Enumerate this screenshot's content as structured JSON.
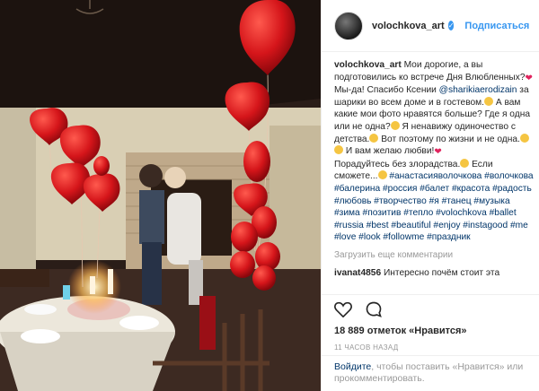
{
  "post": {
    "username": "volochkova_art",
    "verified_mark": "✓",
    "follow_label": "Подписаться"
  },
  "caption": {
    "author": "volochkova_art",
    "text_1": " Мои дорогие, а вы подготовились ко встрече Дня Влюбленных?",
    "text_2": " Мы-да! Спасибо Ксении ",
    "mention": "@sharikiaerodizain",
    "text_3": " за шарики во всем доме и в гостевом.",
    "text_4": " А вам какие мои фото нравятся больше? Где я одна или не одна?",
    "text_5": " Я ненавижу одиночество с детства.",
    "text_6": " Вот поэтому по жизни и не одна.",
    "text_7": " И вам желаю любви!",
    "text_8": "Порадуйтесь без злорадства.",
    "text_9": " Если сможете...",
    "hashtags": "#анастасияволочкова #волочкова #балерина #россия #балет #красота #радость #любовь #творчество #я #танец #музыка #зима #позитив #тепло #volochkova #ballet #russia #best #beautiful #enjoy #instagood #me #love #look #followme #праздник"
  },
  "load_more": "Загрузить еще комментарии",
  "comment": {
    "author": "ivanat4856",
    "text": " Интересно почём стоит эта"
  },
  "likes_text": "18 889 отметок «Нравится»",
  "time_ago": "11 ЧАСОВ НАЗАД",
  "login": {
    "link": "Войдите",
    "text": ", чтобы поставить «Нравится» или прокомментировать."
  },
  "colors": {
    "accent": "#3897f0",
    "link": "#003569",
    "balloon": "#d9141b"
  },
  "icons": [
    "heart-outline-icon",
    "comment-icon",
    "verified-icon"
  ]
}
